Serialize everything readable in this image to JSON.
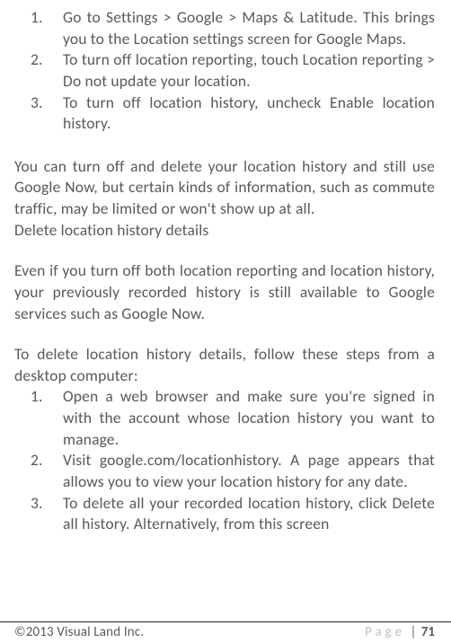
{
  "list1": {
    "items": [
      {
        "num": "1.",
        "text": "Go to   Settings > Google > Maps & Latitude. This brings you to the Location settings screen for Google Maps."
      },
      {
        "num": "2.",
        "text": "To turn off location reporting, touch Location reporting > Do not update your location."
      },
      {
        "num": "3.",
        "text": "To turn off location history, uncheck Enable location history."
      }
    ]
  },
  "para1": "You can turn off and delete your location history and still use Google Now, but certain kinds of information, such as commute traffic, may be limited or won't show up at all.",
  "heading1": "Delete location history details",
  "para2": "Even if you turn off both location reporting and location history, your previously recorded history is still available to Google services such as Google Now.",
  "para3": "To delete location history details, follow these steps from a desktop computer:",
  "list2": {
    "items": [
      {
        "num": "1.",
        "text": "Open a web browser and make sure you're signed in with the account whose location history you want to manage."
      },
      {
        "num": "2.",
        "text": "Visit google.com/locationhistory. A page appears that allows you to view your location history for any date."
      },
      {
        "num": "3.",
        "text": "To delete all your recorded location history, click Delete all history. Alternatively, from this screen"
      }
    ]
  },
  "footer": {
    "copyright": "©2013 Visual Land Inc.",
    "page_label": "Page",
    "sep": " | ",
    "page_num": "71"
  }
}
